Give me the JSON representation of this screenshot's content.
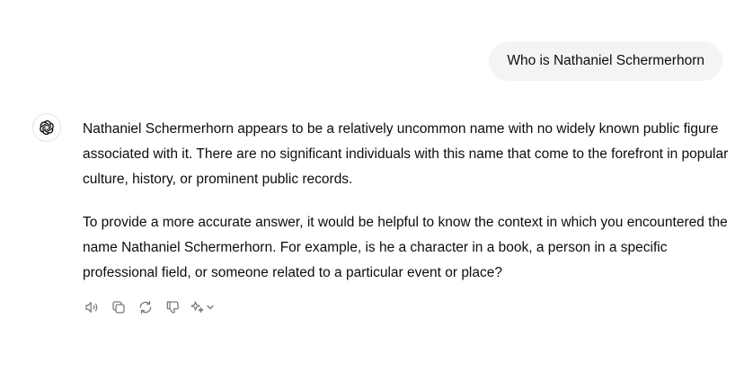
{
  "user_message": {
    "text": "Who is Nathaniel Schermerhorn"
  },
  "assistant_message": {
    "avatar_icon": "openai-logo-icon",
    "paragraphs": [
      "Nathaniel Schermerhorn appears to be a relatively uncommon name with no widely known public figure associated with it. There are no significant individuals with this name that come to the forefront in popular culture, history, or prominent public records.",
      "To provide a more accurate answer, it would be helpful to know the context in which you encountered the name Nathaniel Schermerhorn. For example, is he a character in a book, a person in a specific professional field, or someone related to a particular event or place?"
    ]
  },
  "actions": [
    {
      "icon": "speaker-icon"
    },
    {
      "icon": "copy-icon"
    },
    {
      "icon": "regenerate-icon"
    },
    {
      "icon": "thumbs-down-icon"
    },
    {
      "icon": "sparkle-icon"
    }
  ],
  "colors": {
    "bubble_bg": "#f4f4f4",
    "text": "#0d0d0d",
    "icon": "#7a7a7a"
  }
}
